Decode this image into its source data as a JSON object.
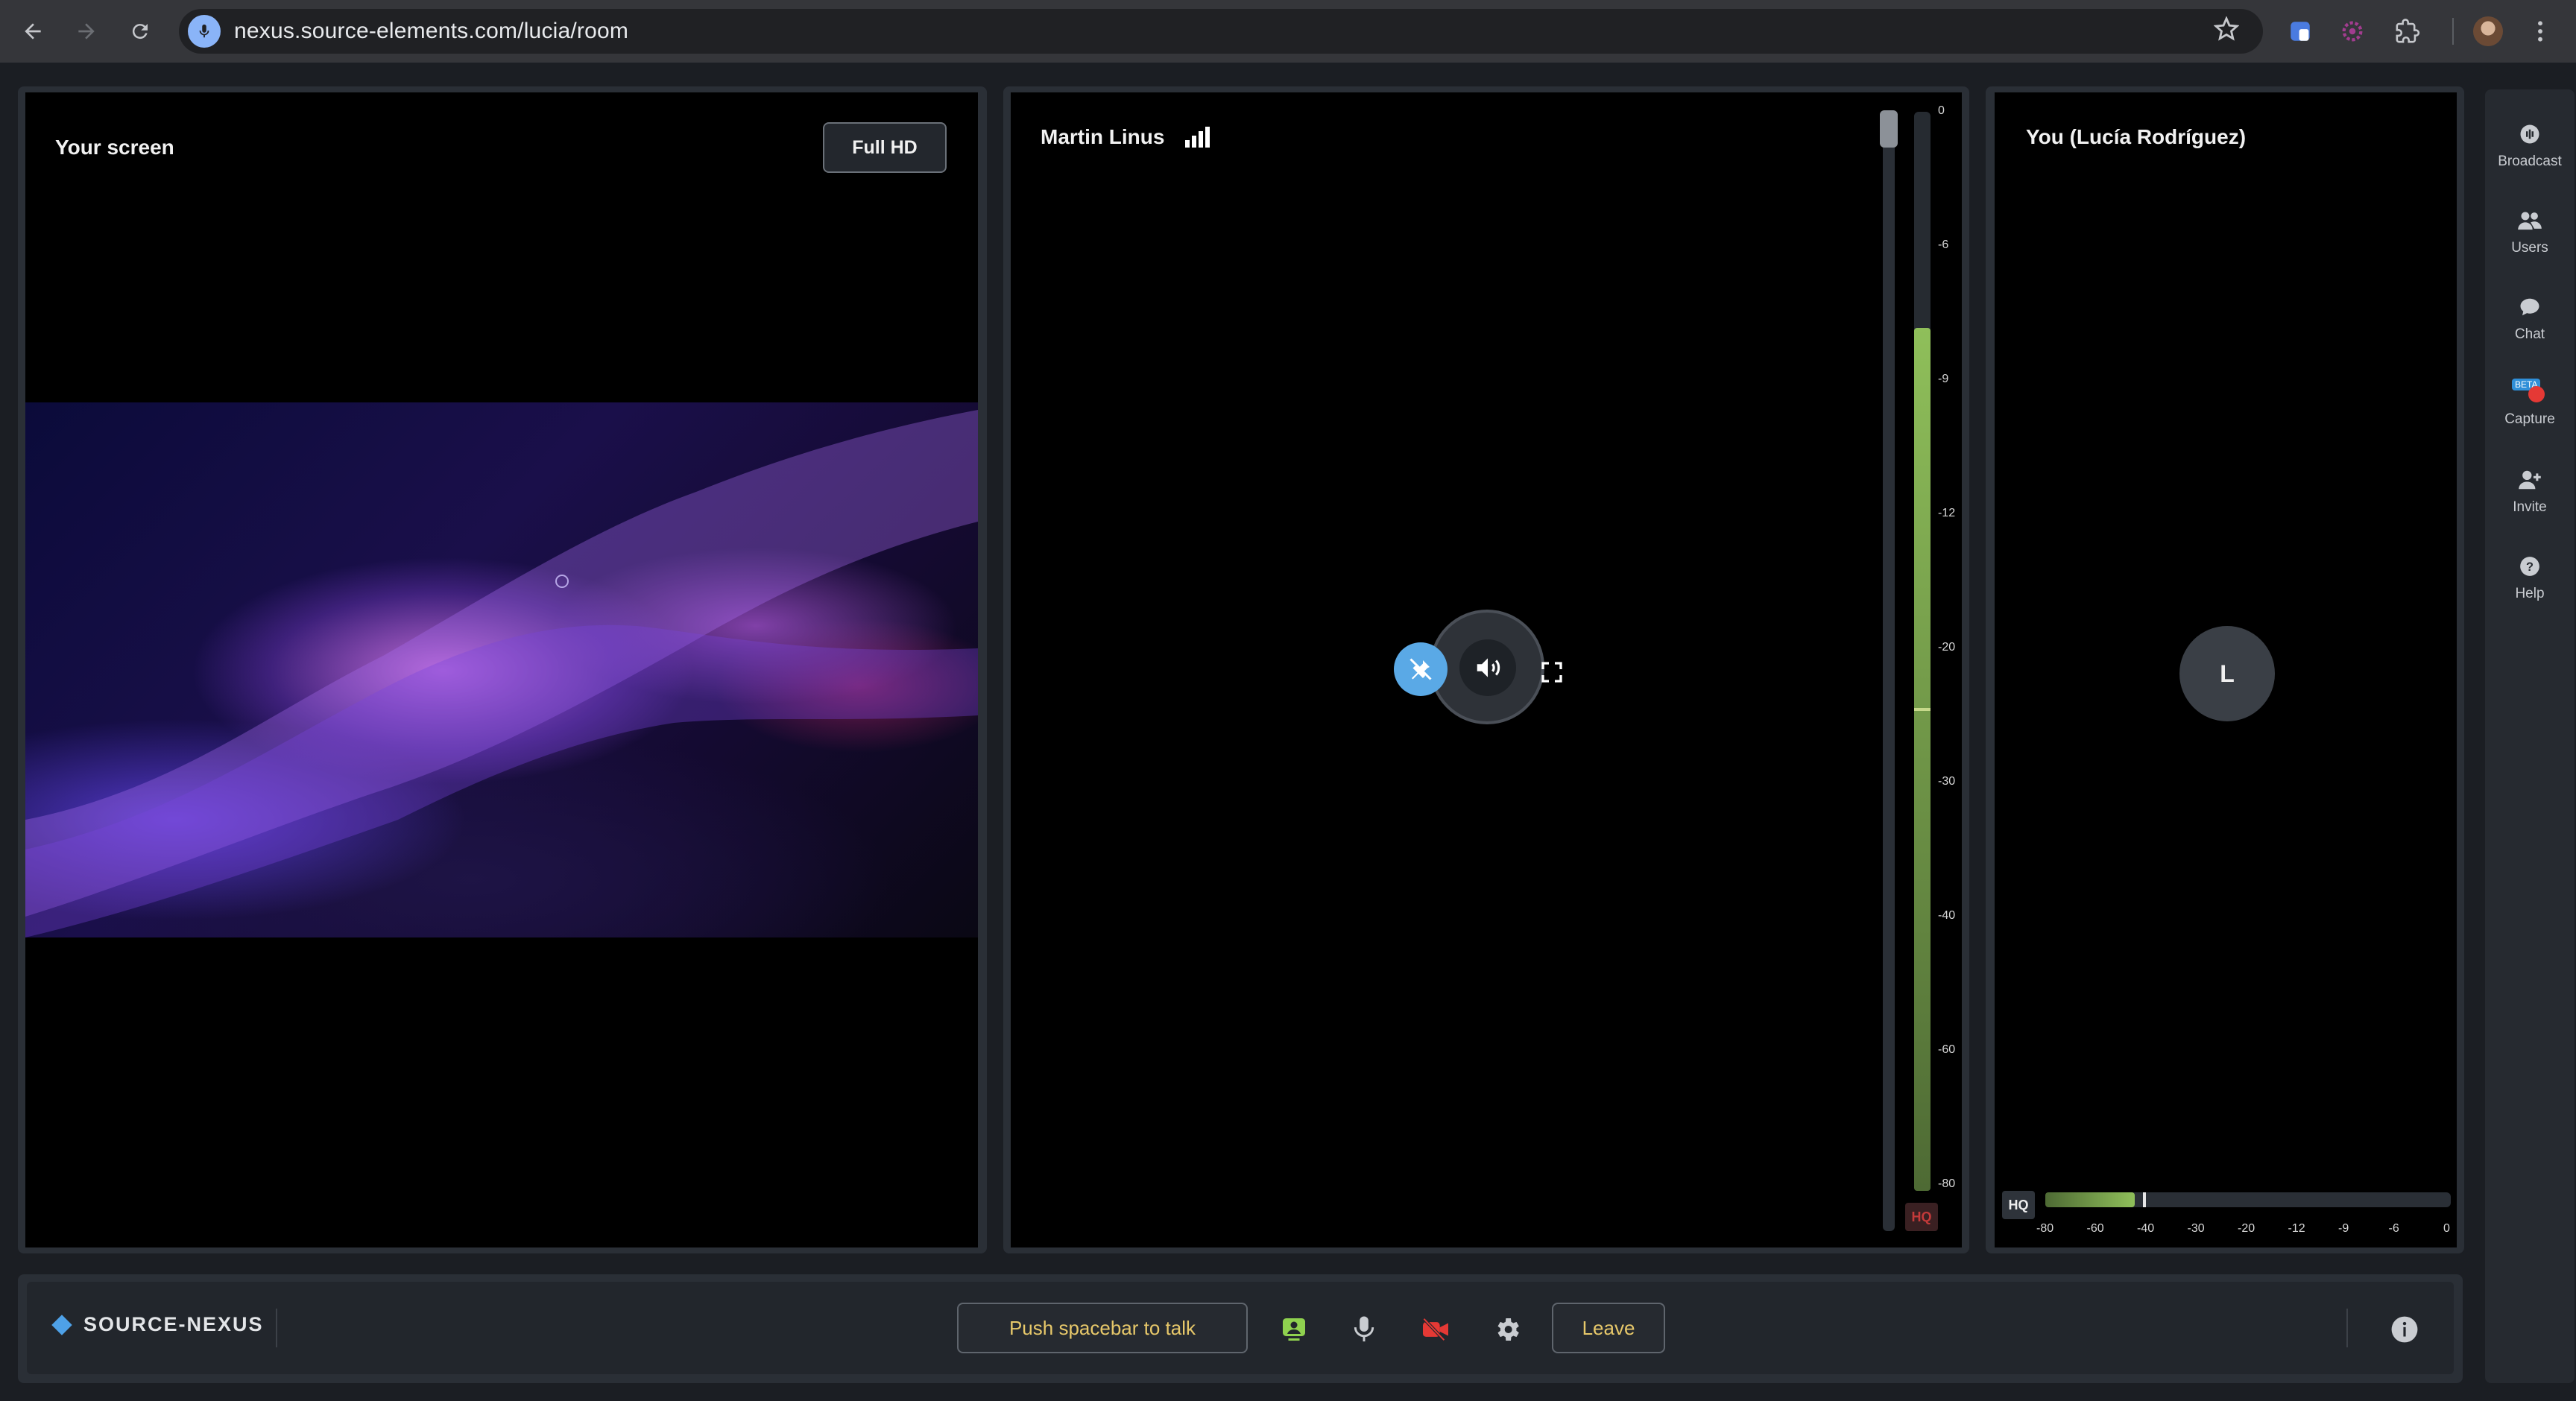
{
  "browser": {
    "url": "nexus.source-elements.com/lucia/room",
    "icons": [
      "back-arrow-icon",
      "forward-arrow-icon",
      "reload-icon",
      "microphone-icon",
      "star-icon",
      "extension-icons",
      "profile-avatar",
      "menu-dots-icon"
    ]
  },
  "screen_panel": {
    "title": "Your screen",
    "quality_button": "Full HD"
  },
  "remote_panel": {
    "name": "Martin Linus",
    "signal_icon": "signal-bars-icon",
    "controls": [
      "unpin-icon",
      "speaker-icon",
      "fullscreen-icon"
    ],
    "meter_ticks": [
      "0",
      "-6",
      "-9",
      "-12",
      "-20",
      "-30",
      "-40",
      "-60",
      "-80"
    ],
    "meter_level_fraction": 0.8,
    "hq_label": "HQ"
  },
  "self_panel": {
    "name": "You (Lucía Rodríguez)",
    "avatar_initial": "L",
    "hq_label": "HQ",
    "meter_ticks": [
      "-80",
      "-60",
      "-40",
      "-30",
      "-20",
      "-12",
      "-9",
      "-6",
      "0"
    ],
    "meter_level_fraction": 0.22
  },
  "sidebar": {
    "items": [
      {
        "label": "Broadcast",
        "icon": "broadcast-icon"
      },
      {
        "label": "Users",
        "icon": "users-icon"
      },
      {
        "label": "Chat",
        "icon": "chat-icon"
      },
      {
        "label": "Capture",
        "icon": "capture-icon",
        "badge": "BETA"
      },
      {
        "label": "Invite",
        "icon": "invite-icon"
      },
      {
        "label": "Help",
        "icon": "help-icon"
      }
    ]
  },
  "bottom_bar": {
    "brand": "SOURCE-NEXUS",
    "push_to_talk": "Push spacebar to talk",
    "leave": "Leave",
    "tools": [
      "screen-share-icon",
      "microphone-icon",
      "camera-off-icon",
      "settings-icon",
      "info-icon"
    ]
  },
  "colors": {
    "accent_yellow": "#e7c86a",
    "meter_green": "#8fbf5a",
    "record_red": "#e53935",
    "unpin_blue": "#5aa9e6"
  }
}
